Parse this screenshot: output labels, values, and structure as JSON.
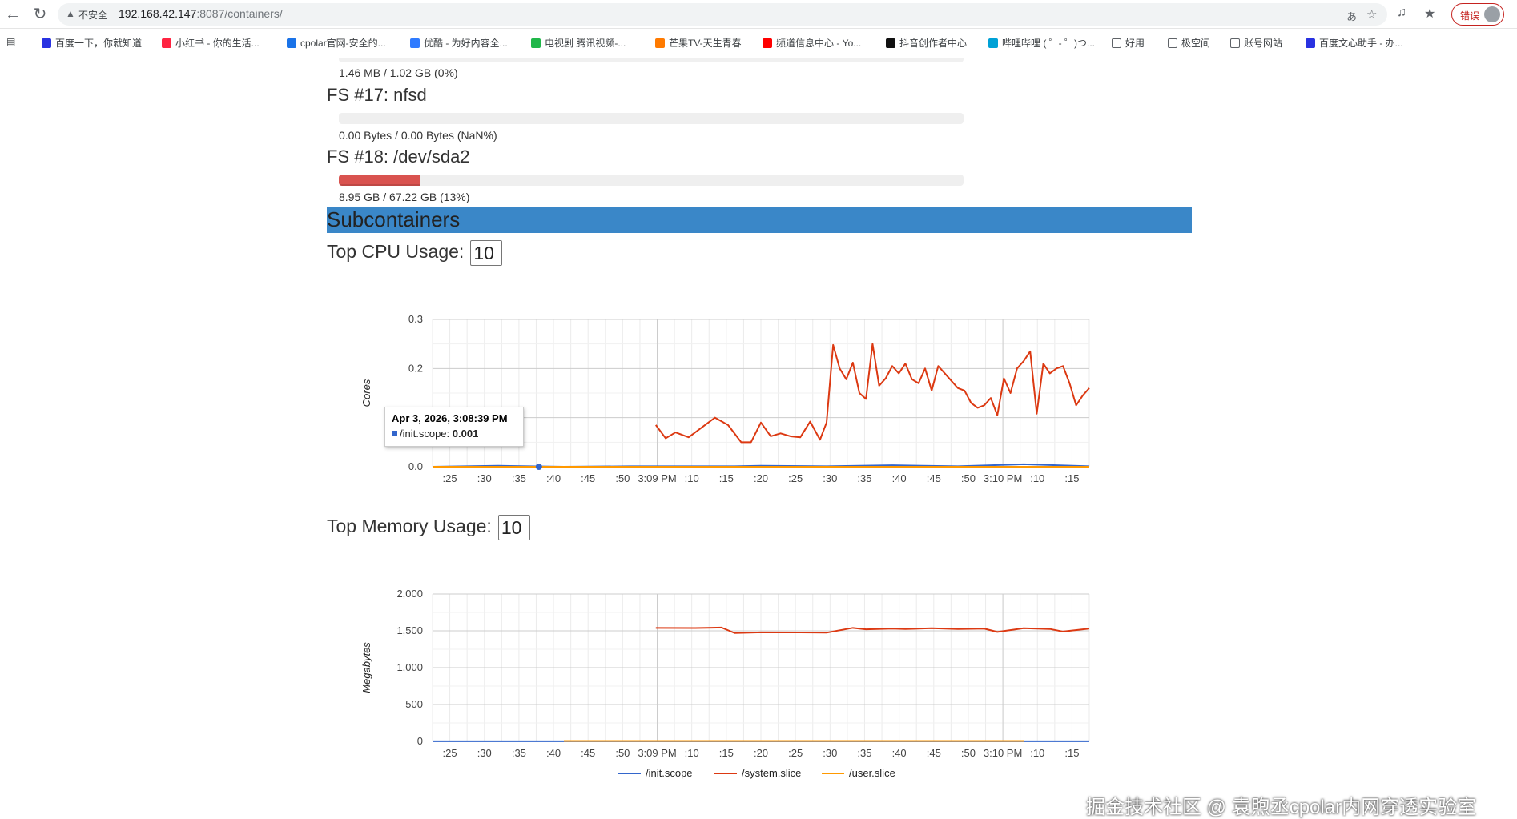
{
  "browser": {
    "insecure_label": "不安全",
    "url_host": "192.168.42.147",
    "url_rest": ":8087/containers/",
    "error_label": "错误",
    "bookmarks": [
      {
        "label": "百度一下，你就知道",
        "color": "#2932e1"
      },
      {
        "label": "小红书 - 你的生活...",
        "color": "#ff2442"
      },
      {
        "label": "cpolar官网-安全的...",
        "color": "#1a73e8"
      },
      {
        "label": "优酷 - 为好内容全...",
        "color": "#2f7bff"
      },
      {
        "label": "电视剧 腾讯视频-...",
        "color": "#20b74a"
      },
      {
        "label": "芒果TV-天生青春",
        "color": "#ff7a00"
      },
      {
        "label": "频道信息中心 - Yo...",
        "color": "#ff0000"
      },
      {
        "label": "抖音创作者中心",
        "color": "#111111"
      },
      {
        "label": "哔哩哔哩 ( ゜- ゜)つ...",
        "color": "#00a1d6"
      },
      {
        "label": "好用",
        "color": "folder"
      },
      {
        "label": "极空间",
        "color": "folder"
      },
      {
        "label": "账号网站",
        "color": "folder"
      },
      {
        "label": "百度文心助手 - 办...",
        "color": "#2932e1"
      }
    ]
  },
  "filesystems": {
    "fs16_usage": "1.46 MB / 1.02 GB (0%)",
    "fs17_title": "FS #17: nfsd",
    "fs17_usage": "0.00 Bytes / 0.00 Bytes (NaN%)",
    "fs17_percent": 0,
    "fs18_title": "FS #18: /dev/sda2",
    "fs18_usage": "8.95 GB / 67.22 GB (13%)",
    "fs18_percent": 13
  },
  "subcontainers": {
    "title": "Subcontainers",
    "cpu_label": "Top CPU Usage:",
    "cpu_value": "10",
    "mem_label": "Top Memory Usage:",
    "mem_value": "10"
  },
  "tooltip": {
    "title": "Apr 3, 2026, 3:08:39 PM",
    "series": "/init.scope:",
    "value": "0.001"
  },
  "chart_data": [
    {
      "type": "line",
      "ylabel": "Cores",
      "ylim": [
        0,
        0.3
      ],
      "yticks": [
        "0.3",
        "0.2",
        "0.1",
        "0.0"
      ],
      "x_ticks": [
        ":25",
        ":30",
        ":35",
        ":40",
        ":45",
        ":50",
        "3:09 PM",
        ":10",
        ":15",
        ":20",
        ":25",
        ":30",
        ":35",
        ":40",
        ":45",
        ":50",
        "3:10 PM",
        ":10",
        ":15"
      ],
      "grid": true,
      "legend": "bottom",
      "series": [
        {
          "name": "/init.scope",
          "color": "#3366cc",
          "x": [
            0,
            10,
            20,
            30,
            40,
            46,
            50,
            60,
            70,
            80,
            90,
            100
          ],
          "values": [
            0.0,
            0.002,
            0.0,
            0.001,
            0.001,
            0.001,
            0.002,
            0.001,
            0.003,
            0.001,
            0.005,
            0.001
          ]
        },
        {
          "name": "/system.slice",
          "color": "#dc3912",
          "x": [
            34,
            35.5,
            37,
            39,
            41,
            43,
            45,
            47,
            48.5,
            50,
            51.5,
            53,
            54.5,
            56,
            57.5,
            59,
            60,
            61,
            62,
            63,
            64,
            65,
            66,
            67,
            68,
            69,
            70,
            71,
            72,
            73,
            74,
            75,
            76,
            77,
            78,
            79,
            80,
            81,
            82,
            83,
            84,
            85,
            86,
            87,
            88,
            89,
            90,
            91,
            92,
            93,
            94,
            95,
            96,
            97,
            98,
            99,
            100
          ],
          "values": [
            0.085,
            0.058,
            0.07,
            0.06,
            0.08,
            0.1,
            0.085,
            0.05,
            0.05,
            0.09,
            0.062,
            0.068,
            0.062,
            0.06,
            0.092,
            0.055,
            0.09,
            0.248,
            0.2,
            0.178,
            0.212,
            0.15,
            0.138,
            0.25,
            0.165,
            0.18,
            0.205,
            0.19,
            0.21,
            0.178,
            0.17,
            0.2,
            0.155,
            0.205,
            0.19,
            0.175,
            0.16,
            0.155,
            0.13,
            0.12,
            0.125,
            0.14,
            0.105,
            0.18,
            0.15,
            0.2,
            0.215,
            0.235,
            0.108,
            0.21,
            0.19,
            0.2,
            0.205,
            0.17,
            0.125,
            0.145,
            0.16
          ]
        },
        {
          "name": "/user.slice",
          "color": "#ff9900",
          "x": [
            0,
            20,
            40,
            60,
            80,
            100
          ],
          "values": [
            0.0,
            0.0,
            0.0,
            0.0,
            0.0,
            0.0
          ]
        }
      ]
    },
    {
      "type": "line",
      "ylabel": "Megabytes",
      "ylim": [
        0,
        2000
      ],
      "yticks": [
        "2,000",
        "1,500",
        "1,000",
        "500",
        "0"
      ],
      "x_ticks": [
        ":25",
        ":30",
        ":35",
        ":40",
        ":45",
        ":50",
        "3:09 PM",
        ":10",
        ":15",
        ":20",
        ":25",
        ":30",
        ":35",
        ":40",
        ":45",
        ":50",
        "3:10 PM",
        ":10",
        ":15"
      ],
      "grid": true,
      "legend": "bottom",
      "series": [
        {
          "name": "/init.scope",
          "color": "#3366cc",
          "x": [
            0,
            100
          ],
          "values": [
            2,
            2
          ]
        },
        {
          "name": "/system.slice",
          "color": "#dc3912",
          "x": [
            34,
            40,
            44,
            46,
            50,
            56,
            60,
            64,
            66,
            70,
            72,
            76,
            80,
            84,
            86,
            90,
            94,
            96,
            100
          ],
          "values": [
            1540,
            1538,
            1545,
            1470,
            1480,
            1478,
            1475,
            1540,
            1520,
            1530,
            1525,
            1535,
            1525,
            1530,
            1485,
            1535,
            1525,
            1490,
            1530
          ]
        },
        {
          "name": "/user.slice",
          "color": "#ff9900",
          "x": [
            20,
            90
          ],
          "values": [
            5,
            5
          ]
        }
      ]
    }
  ],
  "watermark": "掘金技术社区 @ 袁煦丞cpolar内网穿透实验室"
}
